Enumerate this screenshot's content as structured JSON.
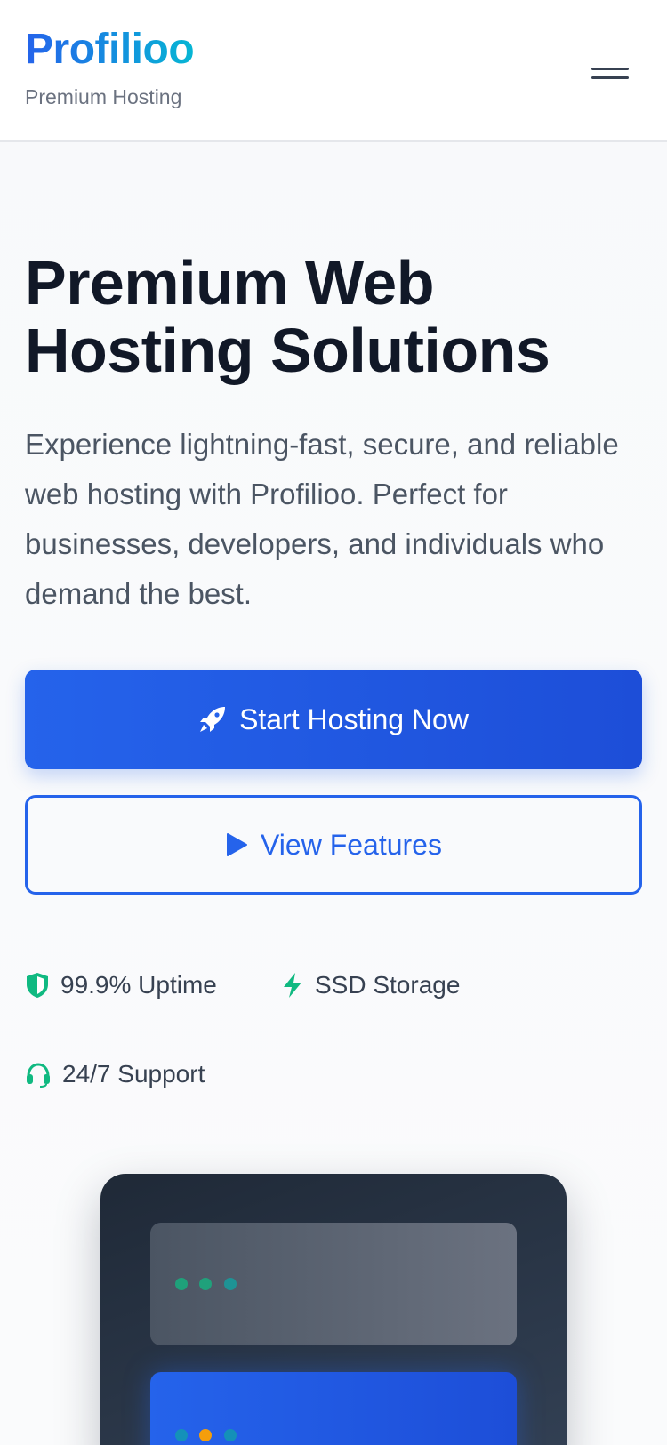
{
  "header": {
    "brand": "Profilioo",
    "tagline": "Premium Hosting",
    "menu_icon": "hamburger-icon"
  },
  "hero": {
    "title_line1": "Premium Web",
    "title_line2": "Hosting Solutions",
    "description": "Experience lightning-fast, secure, and reliable web hosting with Profilioo. Perfect for businesses, developers, and individuals who demand the best."
  },
  "buttons": {
    "primary_label": "Start Hosting Now",
    "primary_icon": "rocket-icon",
    "secondary_label": "View Features",
    "secondary_icon": "play-icon"
  },
  "features": [
    {
      "label": "99.9% Uptime",
      "icon": "shield-icon"
    },
    {
      "label": "SSD Storage",
      "icon": "bolt-icon"
    },
    {
      "label": "24/7 Support",
      "icon": "headset-icon"
    }
  ],
  "colors": {
    "primary": "#2563eb",
    "accent": "#06b6d4",
    "feature_icon": "#10b981",
    "text_dark": "#111827",
    "text_muted": "#4b5563",
    "led_green": "#10b981",
    "led_teal": "#0ea5a4",
    "led_orange": "#f59e0b"
  }
}
